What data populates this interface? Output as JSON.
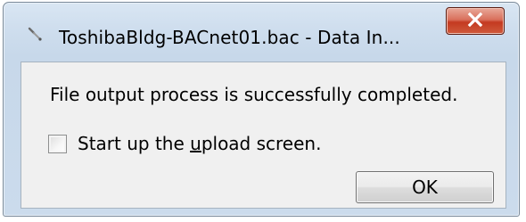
{
  "window": {
    "title": "ToshibaBldg-BACnet01.bac - Data In...",
    "icon": "wrench-tool-icon",
    "close_icon": "close-x-icon",
    "accent_close_color": "#c43a21"
  },
  "dialog": {
    "message": "File output process is successfully completed.",
    "checkbox": {
      "label_pre": "Start up the ",
      "label_underlined": "u",
      "label_post": "pload screen.",
      "checked": false
    },
    "ok_label": "OK"
  }
}
